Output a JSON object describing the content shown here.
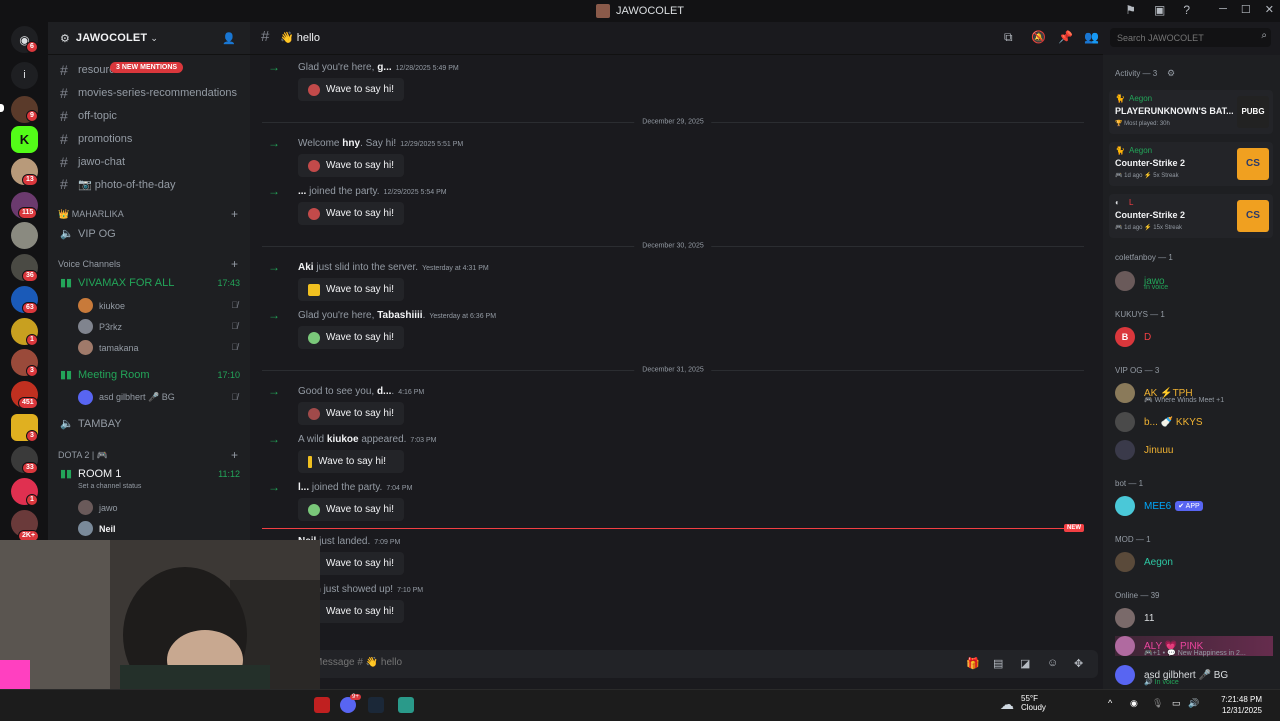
{
  "window": {
    "title": "JAWOCOLET"
  },
  "server_rail": {
    "badges": [
      "6",
      "9",
      "13",
      "115",
      "36",
      "63",
      "1",
      "3",
      "451",
      "3",
      "33",
      "1",
      "2K+"
    ]
  },
  "sidebar": {
    "guild_name": "JAWOCOLET",
    "mentions_pill": "3 NEW MENTIONS",
    "text_channels": [
      "resourc",
      "movies-series-recommendations",
      "off-topic",
      "promotions",
      "jawo-chat",
      "📷 photo-of-the-day"
    ],
    "category_maharlika": "👑 MAHARLIKA",
    "vip_og": "VIP OG",
    "category_voice": "Voice Channels",
    "voice": [
      {
        "name": "VIVAMAX FOR ALL",
        "time": "17:43",
        "users": [
          "kiukoe",
          "P3rkz",
          "tamakana"
        ]
      },
      {
        "name": "Meeting Room",
        "time": "17:10",
        "users": [
          "asd gilbhert  🎤 BG"
        ]
      }
    ],
    "tambay": "TAMBAY",
    "category_dota": "DOTA 2 | 🎮",
    "room1": {
      "name": "ROOM 1",
      "time": "11:12",
      "status": "Set a channel status",
      "users": [
        "jawo",
        "Neil"
      ]
    }
  },
  "channel": {
    "name": "👋 hello"
  },
  "messages": [
    {
      "text_pre": "Glad you're here, ",
      "name": "g...",
      "text_post": "",
      "ts": "12/28/2025 5:49 PM",
      "wave": "Wave to say hi!"
    },
    {
      "divider": "December 29, 2025"
    },
    {
      "text_pre": "Welcome ",
      "name": "hny",
      "text_post": ". Say hi!",
      "ts": "12/29/2025 5:51 PM",
      "wave": "Wave to say hi!"
    },
    {
      "text_pre": "",
      "name": "...",
      "text_post": " joined the party.",
      "ts": "12/29/2025 5:54 PM",
      "wave": "Wave to say hi!"
    },
    {
      "divider": "December 30, 2025"
    },
    {
      "text_pre": "",
      "name": "Aki",
      "text_post": " just slid into the server.",
      "ts": "Yesterday at 4:31 PM",
      "wave": "Wave to say hi!"
    },
    {
      "text_pre": "Glad you're here, ",
      "name": "Tabashiiii",
      "text_post": ".",
      "ts": "Yesterday at 6:36 PM",
      "wave": "Wave to say hi!"
    },
    {
      "divider": "December 31, 2025"
    },
    {
      "text_pre": "Good to see you, ",
      "name": "d...",
      "text_post": ".",
      "ts": "4:16 PM",
      "wave": "Wave to say hi!"
    },
    {
      "text_pre": "A wild ",
      "name": "kiukoe",
      "text_post": " appeared.",
      "ts": "7:03 PM",
      "wave": "Wave to say hi!"
    },
    {
      "text_pre": "",
      "name": "l...",
      "text_post": " joined the party.",
      "ts": "7:04 PM",
      "wave": "Wave to say hi!"
    },
    {
      "new": "NEW"
    },
    {
      "text_pre": "",
      "name": "Neil",
      "text_post": " just landed.",
      "ts": "7:09 PM",
      "wave": "Wave to say hi!"
    },
    {
      "text_pre": "",
      "name": "allen",
      "text_post": " just showed up!",
      "ts": "7:10 PM",
      "wave": "Wave to say hi!"
    }
  ],
  "composer": {
    "placeholder": "Message # 👋 hello"
  },
  "search": {
    "placeholder": "Search JAWOCOLET"
  },
  "members": {
    "activity_title": "Activity — 3",
    "activity": [
      {
        "user": "Aegon",
        "game": "PLAYERUNKNOWN'S BAT...",
        "meta": "🏆 Most played: 30h",
        "icon": "PUBG"
      },
      {
        "user": "Aegon",
        "game": "Counter-Strike 2",
        "meta": "🎮 1d ago   ⚡ 5x Streak",
        "icon": "CS"
      },
      {
        "user": "L",
        "game": "Counter-Strike 2",
        "meta": "🎮 1d ago   ⚡ 15x Streak",
        "icon": "CS"
      }
    ],
    "groups": [
      {
        "title": "coletfanboy — 1",
        "members": [
          {
            "name": "jawo",
            "sub": "In voice",
            "color": "#23a559"
          }
        ]
      },
      {
        "title": "KUKUYS — 1",
        "members": [
          {
            "name": "D",
            "sub": "",
            "color": "#f23f43"
          }
        ]
      },
      {
        "title": "VIP OG — 3",
        "members": [
          {
            "name": "AK  ⚡TPH",
            "sub": "🎮 Where Winds Meet +1",
            "color": "#f0b232"
          },
          {
            "name": "b...  🍼 KKYS",
            "sub": "",
            "color": "#f0b232"
          },
          {
            "name": "Jinuuu",
            "sub": "",
            "color": "#f0b232"
          }
        ]
      },
      {
        "title": "bot — 1",
        "members": [
          {
            "name": "MEE6",
            "sub": "",
            "color": "#00a8fc",
            "tag": "✔ APP"
          }
        ]
      },
      {
        "title": "MOD — 1",
        "members": [
          {
            "name": "Aegon",
            "sub": "",
            "color": "#2dc7a3"
          }
        ]
      },
      {
        "title": "Online — 39",
        "members": [
          {
            "name": "11",
            "sub": "",
            "color": "#dbdee1"
          },
          {
            "name": "ALY  💗 PINK",
            "sub": "🎮+1 • 💬 New Happiness in 2...",
            "color": "#eb459e"
          },
          {
            "name": "asd gilbhert  🎤 BG",
            "sub": "🔊 In voice",
            "color": "#dbdee1"
          }
        ]
      }
    ]
  },
  "taskbar": {
    "temp": "55°F",
    "weather": "Cloudy",
    "time": "7:21:48 PM",
    "date": "12/31/2025",
    "discord_badge": "9+"
  }
}
